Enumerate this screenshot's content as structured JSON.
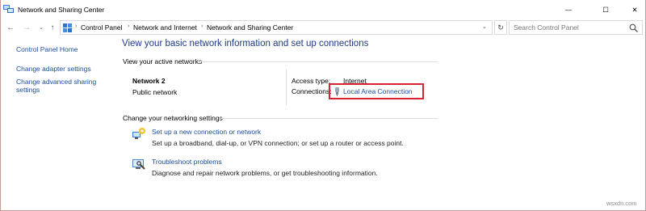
{
  "window": {
    "title": "Network and Sharing Center",
    "controls": {
      "minimize": "—",
      "maximize": "☐",
      "close": "✕"
    }
  },
  "address_bar": {
    "breadcrumbs": [
      "Control Panel",
      "Network and Internet",
      "Network and Sharing Center"
    ],
    "search_placeholder": "Search Control Panel"
  },
  "sidebar": {
    "items": [
      {
        "label": "Control Panel Home"
      },
      {
        "label": "Change adapter settings"
      },
      {
        "label": "Change advanced sharing settings"
      }
    ]
  },
  "main": {
    "heading": "View your basic network information and set up connections",
    "active_networks_label": "View your active networks",
    "network": {
      "name": "Network  2",
      "type": "Public network",
      "access_type_label": "Access type:",
      "access_type_value": "Internet",
      "connections_label": "Connections:",
      "connection_link": "Local Area Connection"
    },
    "settings_label": "Change your networking settings",
    "tasks": [
      {
        "link": "Set up a new connection or network",
        "desc": "Set up a broadband, dial-up, or VPN connection; or set up a router or access point.",
        "icon": "network-setup-icon"
      },
      {
        "link": "Troubleshoot problems",
        "desc": "Diagnose and repair network problems, or get troubleshooting information.",
        "icon": "troubleshoot-icon"
      }
    ]
  },
  "watermark": "wsxdn.com",
  "colors": {
    "link": "#1c4d99",
    "heading": "#1e3a8a",
    "highlight": "#d62430"
  }
}
